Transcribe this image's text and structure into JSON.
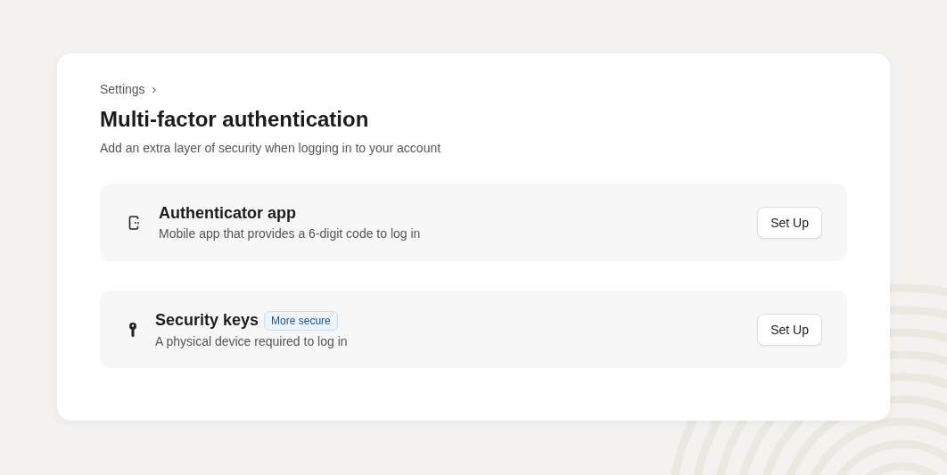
{
  "breadcrumb": {
    "label": "Settings",
    "separator": "›"
  },
  "title": "Multi-factor authentication",
  "subtitle": "Add an extra layer of security when logging in to your account",
  "methods": [
    {
      "kind": "app",
      "title": "Authenticator app",
      "description": "Mobile app that provides a 6-digit code to log in",
      "button": "Set Up"
    },
    {
      "kind": "key",
      "title": "Security keys",
      "badge": "More secure",
      "description": "A physical device required to log in",
      "button": "Set Up"
    }
  ]
}
